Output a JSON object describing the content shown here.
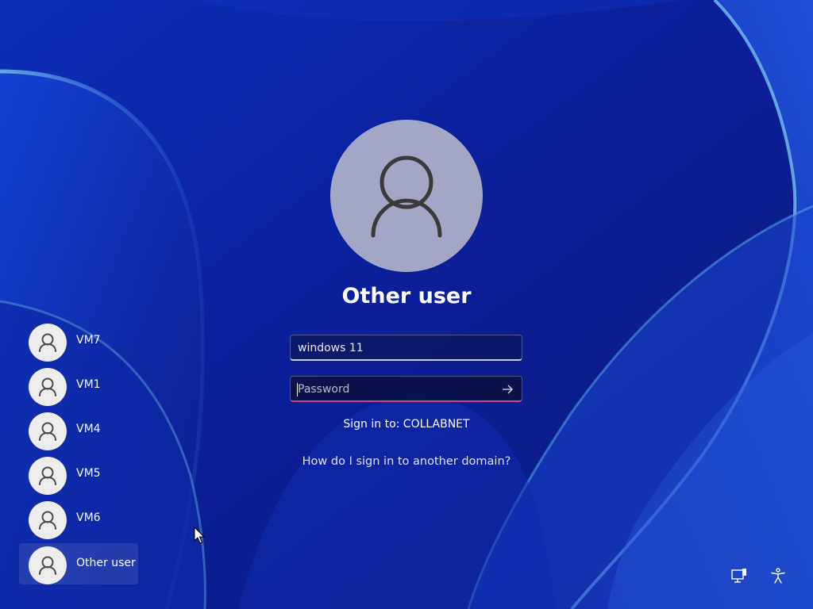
{
  "lock_screen": {
    "selected_user": "Other user",
    "username_value": "windows 11",
    "password_placeholder": "Password",
    "signin_domain_text": "Sign in to: COLLABNET",
    "other_domain_link": "How do I sign in to another domain?"
  },
  "user_list": [
    {
      "label": "VM7",
      "selected": false
    },
    {
      "label": "VM1",
      "selected": false
    },
    {
      "label": "VM4",
      "selected": false
    },
    {
      "label": "VM5",
      "selected": false
    },
    {
      "label": "VM6",
      "selected": false
    },
    {
      "label": "Other user",
      "selected": true
    }
  ],
  "icons": {
    "avatar": "person-icon",
    "submit": "arrow-right-icon",
    "network": "network-icon",
    "accessibility": "accessibility-icon",
    "cursor": "mouse-pointer-icon"
  },
  "colors": {
    "wallpaper_base": "#0c22a3",
    "avatar_large_bg": "#a3a6c4",
    "avatar_small_bg": "#ededee",
    "password_accent": "#c5449c",
    "text": "#ffffff"
  }
}
